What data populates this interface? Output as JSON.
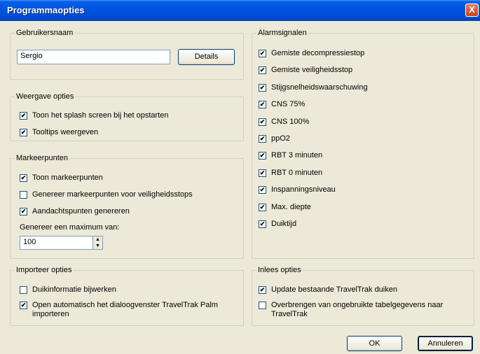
{
  "window": {
    "title": "Programmaopties",
    "close_glyph": "X"
  },
  "gebruikersnaam": {
    "legend": "Gebruikersnaam",
    "value": "Sergio",
    "details_label": "Details"
  },
  "weergave": {
    "legend": "Weergave opties",
    "items": [
      {
        "label": "Toon het splash screen bij het opstarten",
        "checked": true
      },
      {
        "label": "Tooltips weergeven",
        "checked": true
      }
    ]
  },
  "markeerpunten": {
    "legend": "Markeerpunten",
    "items": [
      {
        "label": "Toon markeerpunten",
        "checked": true
      },
      {
        "label": "Genereer markeerpunten voor veiligheidsstops",
        "checked": false
      },
      {
        "label": "Aandachtspunten genereren",
        "checked": true
      }
    ],
    "max_label": "Genereer een maximum van:",
    "max_value": "100"
  },
  "alarm": {
    "legend": "Alarmsignalen",
    "items": [
      {
        "label": "Gemiste decompressiestop",
        "checked": true
      },
      {
        "label": "Gemiste veiligheidsstop",
        "checked": true
      },
      {
        "label": "Stijgsnelheidswaarschuwing",
        "checked": true
      },
      {
        "label": "CNS 75%",
        "checked": true
      },
      {
        "label": "CNS 100%",
        "checked": true
      },
      {
        "label": "ppO2",
        "checked": true
      },
      {
        "label": "RBT 3 minuten",
        "checked": true
      },
      {
        "label": "RBT 0 minuten",
        "checked": true
      },
      {
        "label": "Inspanningsniveau",
        "checked": true
      },
      {
        "label": "Max. diepte",
        "checked": true
      },
      {
        "label": "Duiktijd",
        "checked": true
      }
    ]
  },
  "importeer": {
    "legend": "Importeer opties",
    "items": [
      {
        "label": "Duikinformatie bijwerken",
        "checked": false
      },
      {
        "label": "Open automatisch het dialoogvenster TravelTrak Palm importeren",
        "checked": true
      }
    ]
  },
  "inlees": {
    "legend": "Inlees opties",
    "items": [
      {
        "label": "Update bestaande TravelTrak duiken",
        "checked": true
      },
      {
        "label": "Overbrengen van ongebruikte tabelgegevens naar TravelTrak",
        "checked": false
      }
    ]
  },
  "footer": {
    "ok_label": "OK",
    "cancel_label": "Annuleren"
  }
}
